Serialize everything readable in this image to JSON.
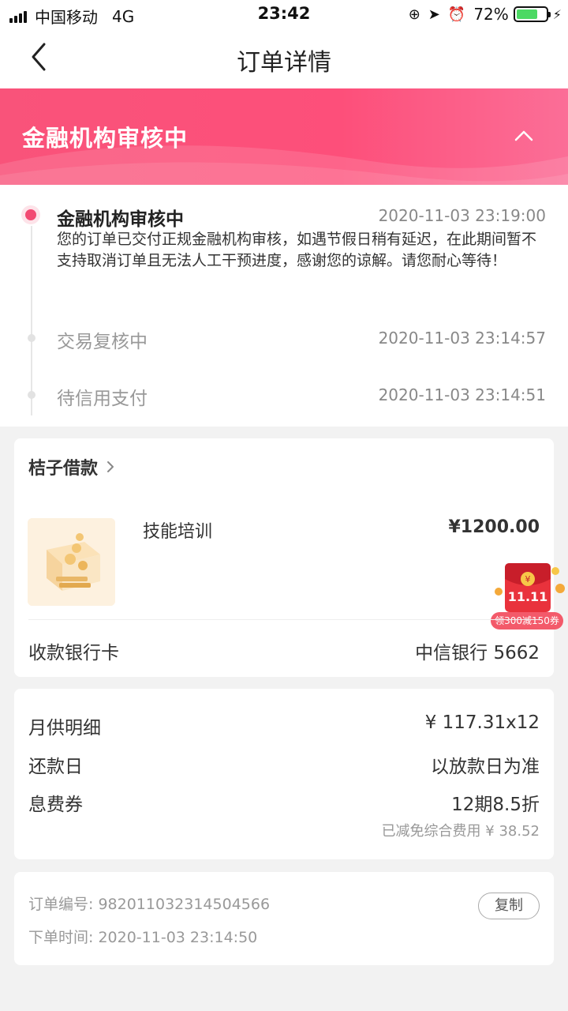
{
  "status_bar": {
    "carrier": "中国移动",
    "network": "4G",
    "time": "23:42",
    "battery": "72%",
    "battery_level": 0.72
  },
  "nav": {
    "title": "订单详情"
  },
  "banner": {
    "status": "金融机构审核中"
  },
  "timeline": [
    {
      "title": "金融机构审核中",
      "time": "2020-11-03 23:19:00",
      "desc": "您的订单已交付正规金融机构审核，如遇节假日稍有延迟，在此期间暂不支持取消订单且无法人工干预进度，感谢您的谅解。请您耐心等待！"
    },
    {
      "title": "交易复核中",
      "time": "2020-11-03 23:14:57"
    },
    {
      "title": "待信用支付",
      "time": "2020-11-03 23:14:51"
    }
  ],
  "order": {
    "lender": "桔子借款",
    "product_name": "技能培训",
    "price": "¥1200.00",
    "promo_label": "领300减150券",
    "promo_badge": "11.11",
    "promo_symbol": "¥",
    "bank_label": "收款银行卡",
    "bank_value": "中信银行 5662"
  },
  "repayment": {
    "monthly_label": "月供明细",
    "monthly_value": "¥ 117.31x12",
    "date_label": "还款日",
    "date_value": "以放款日为准",
    "coupon_label": "息费券",
    "coupon_value": "12期8.5折",
    "coupon_note": "已减免综合费用 ¥ 38.52"
  },
  "meta": {
    "order_no_label": "订单编号:",
    "order_no": "982011032314504566",
    "order_time_label": "下单时间:",
    "order_time": "2020-11-03 23:14:50",
    "copy_label": "复制"
  },
  "colors": {
    "accent": "#f24a72",
    "banner": "#fd4f7a"
  }
}
